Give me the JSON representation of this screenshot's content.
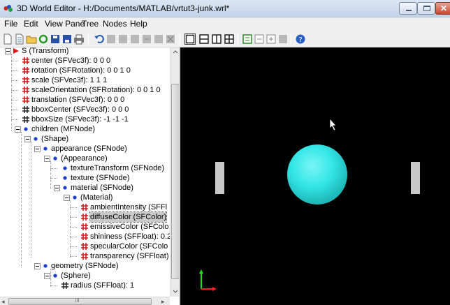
{
  "window": {
    "title": "3D World Editor - H:/Documents/MATLAB/vrtut3-junk.wrl*",
    "close_glyph": "✕"
  },
  "menu": [
    "File",
    "Edit",
    "View Pane",
    "Tree",
    "Nodes",
    "Help"
  ],
  "toolbar": {
    "icons": [
      "new-icon",
      "open-icon",
      "open-folder-icon",
      "reload-icon",
      "save-icon",
      "save-as-icon",
      "print-icon",
      "undo-icon",
      "redo-icon",
      "cut-icon",
      "copy-icon",
      "paste-icon",
      "delete-icon",
      "single-view-icon",
      "horizontal-split-icon",
      "vertical-split-icon",
      "quad-split-icon",
      "collapse-icon",
      "minus-icon",
      "plus-icon",
      "expand-icon",
      "help-icon"
    ]
  },
  "tree": {
    "rows": [
      {
        "text": "S (Transform)",
        "icon": "transform-icon"
      },
      {
        "text": "center (SFVec3f): 0 0 0",
        "icon": "field-icon"
      },
      {
        "text": "rotation (SFRotation): 0 0 1 0",
        "icon": "field-icon"
      },
      {
        "text": "scale (SFVec3f): 1 1 1",
        "icon": "field-icon"
      },
      {
        "text": "scaleOrientation (SFRotation): 0 0 1 0",
        "icon": "field-icon"
      },
      {
        "text": "translation (SFVec3f): 0 0 0",
        "icon": "field-icon"
      },
      {
        "text": "bboxCenter (SFVec3f): 0 0 0",
        "icon": "static-field-icon"
      },
      {
        "text": "bboxSize (SFVec3f): -1 -1 -1",
        "icon": "static-field-icon"
      },
      {
        "text": "children (MFNode)",
        "icon": "node-dot-icon"
      },
      {
        "text": "(Shape)",
        "icon": "node-dot-icon"
      },
      {
        "text": "appearance (SFNode)",
        "icon": "node-dot-icon"
      },
      {
        "text": "(Appearance)",
        "icon": "node-dot-icon"
      },
      {
        "text": "textureTransform (SFNode)",
        "icon": "node-dot-icon"
      },
      {
        "text": "texture (SFNode)",
        "icon": "node-dot-icon"
      },
      {
        "text": "material (SFNode)",
        "icon": "node-dot-icon"
      },
      {
        "text": "(Material)",
        "icon": "node-dot-icon"
      },
      {
        "text": "ambientIntensity (SFFl",
        "icon": "field-icon"
      },
      {
        "text": "diffuseColor (SFColor)",
        "icon": "field-icon"
      },
      {
        "text": "emissiveColor (SFColo",
        "icon": "field-icon"
      },
      {
        "text": "shininess (SFFloat): 0.2",
        "icon": "field-icon"
      },
      {
        "text": "specularColor (SFColo",
        "icon": "field-icon"
      },
      {
        "text": "transparency (SFFloat)",
        "icon": "field-icon"
      },
      {
        "text": "geometry (SFNode)",
        "icon": "node-dot-icon"
      },
      {
        "text": "(Sphere)",
        "icon": "node-dot-icon"
      },
      {
        "text": "radius (SFFloat): 1",
        "icon": "static-field-icon"
      }
    ],
    "selected_row": "diffuseColor (SFColor)",
    "hscroll_glyph": "III"
  },
  "view": {
    "background": "#000000",
    "sphere_color": "#33e6e6",
    "bar_color": "#c8c8c8",
    "axis_x_color": "#ff2020",
    "axis_y_color": "#20e020"
  }
}
